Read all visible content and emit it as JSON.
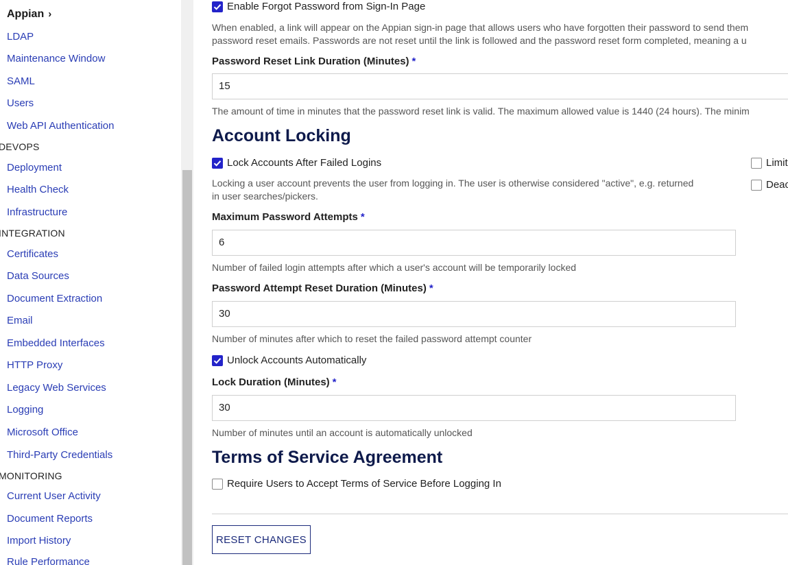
{
  "sidebar": {
    "brand": "Appian",
    "chevron": "›",
    "items": {
      "ldap": "LDAP",
      "maintenance_window": "Maintenance Window",
      "saml": "SAML",
      "users": "Users",
      "web_api_authentication": "Web API Authentication",
      "deployment": "Deployment",
      "health_check": "Health Check",
      "infrastructure": "Infrastructure",
      "certificates": "Certificates",
      "data_sources": "Data Sources",
      "document_extraction": "Document Extraction",
      "email": "Email",
      "embedded_interfaces": "Embedded Interfaces",
      "http_proxy": "HTTP Proxy",
      "legacy_web_services": "Legacy Web Services",
      "logging": "Logging",
      "microsoft_office": "Microsoft Office",
      "third_party_credentials": "Third-Party Credentials",
      "current_user_activity": "Current User Activity",
      "document_reports": "Document Reports",
      "import_history": "Import History",
      "rule_performance": "Rule Performance"
    },
    "sections": {
      "devops": "DEVOPS",
      "integration": "INTEGRATION",
      "monitoring": "MONITORING"
    }
  },
  "main": {
    "forgot_password": {
      "label": "Enable Forgot Password from Sign-In Page",
      "checked": true,
      "help_line1": "When enabled, a link will appear on the Appian sign-in page that allows users who have forgotten their password to send them",
      "help_line2": "password reset emails. Passwords are not reset until the link is followed and the password reset form completed, meaning a u"
    },
    "reset_link_duration": {
      "label": "Password Reset Link Duration (Minutes)",
      "required_mark": "*",
      "value": "15",
      "help": "The amount of time in minutes that the password reset link is valid. The maximum allowed value is 1440 (24 hours). The minim"
    },
    "account_locking": {
      "heading": "Account Locking",
      "lock_after_failed": {
        "label": "Lock Accounts After Failed Logins",
        "checked": true
      },
      "help_line1": "Locking a user account prevents the user from logging in. The user is otherwise considered \"active\", e.g. returned",
      "help_line2": "in user searches/pickers.",
      "right_checkbox_1": {
        "label": "Limit",
        "checked": false
      },
      "right_checkbox_2": {
        "label": "Deac",
        "checked": false
      },
      "max_attempts": {
        "label": "Maximum Password Attempts",
        "required_mark": "*",
        "value": "6",
        "help": "Number of failed login attempts after which a user's account will be temporarily locked"
      },
      "attempt_reset_duration": {
        "label": "Password Attempt Reset Duration (Minutes)",
        "required_mark": "*",
        "value": "30",
        "help": "Number of minutes after which to reset the failed password attempt counter"
      },
      "unlock_automatically": {
        "label": "Unlock Accounts Automatically",
        "checked": true
      },
      "lock_duration": {
        "label": "Lock Duration (Minutes)",
        "required_mark": "*",
        "value": "30",
        "help": "Number of minutes until an account is automatically unlocked"
      }
    },
    "terms_of_service": {
      "heading": "Terms of Service Agreement",
      "require_accept": {
        "label": "Require Users to Accept Terms of Service Before Logging In",
        "checked": false
      }
    },
    "reset_button": "RESET CHANGES"
  },
  "colors": {
    "link": "#2a3db5",
    "checkbox_checked": "#2323c9",
    "heading": "#0e1a4b",
    "button_border": "#1b2a7a"
  },
  "icons": {
    "chevron": "chevron-right-icon",
    "check": "checkmark-icon"
  }
}
